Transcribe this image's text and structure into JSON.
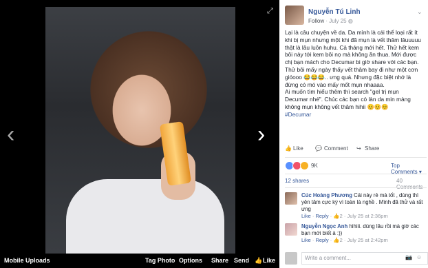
{
  "viewer": {
    "prev_arrow": "‹",
    "next_arrow": "›",
    "expand_icon": "⤢",
    "album": "Mobile Uploads",
    "tag_photo": "Tag Photo",
    "options": "Options",
    "share": "Share",
    "send": "Send",
    "like": "Like"
  },
  "post": {
    "author": "Nguyễn Tú Linh",
    "follow": "Follow",
    "date": "July 25",
    "lines": [
      "Lại là câu chuyện về da. Da mình là cái thể loại rất ít khi bị mụn nhưng một khi đã mụn là vết thâm lâuuuuu thật là lâu luôn huhu. Cả tháng mới hết. Thử hết kem bôi này tới kem bôi nọ mà không ăn thua. Mới được chị bạn mách cho Decumar bi giờ share với các bạn. Thử bôi mấy ngày thấy vết thâm bay đi như một cơn gióooo 😂😂😂.. ưng quá. Nhưng đặc biệt nhớ là đừng có mó vào mấy mốt mụn nhaaaa.",
      "Ai muốn tìm hiểu thêm thì search \"gel trị mụn Decumar nhé\". Chúc các bạn có làn da min màng không mụn không vết thâm hihii 😊😊😊"
    ],
    "hashtag": "#Decumar",
    "actions": {
      "like": "Like",
      "comment": "Comment",
      "share": "Share"
    },
    "reactions_count": "9K",
    "top_comments": "Top Comments ▾",
    "shares": "12 shares",
    "comments_count": "40 Comments"
  },
  "comments": [
    {
      "name": "Cúc Hoàng Phương",
      "text": "Cái này rẻ mà tốt , dùng thì yên tâm cực kỳ vì toàn là nghề . Mình đã thử và rất ưng",
      "like": "Like",
      "reply": "Reply",
      "likes": "2",
      "time": "July 25 at 2:36pm"
    },
    {
      "name": "Nguyễn Ngọc Anh",
      "text": "hihiii. dùng lâu rồi mà giờ các bạn mới biết à :))",
      "like": "Like",
      "reply": "Reply",
      "likes": "2",
      "time": "July 25 at 2:42pm"
    }
  ],
  "write_comment": {
    "placeholder": "Write a comment...",
    "camera_icon": "📷",
    "emoji_icon": "☺"
  },
  "colors": {
    "link": "#365899",
    "like_reaction": "#5890ff",
    "love_reaction": "#f25268",
    "haha_reaction": "#f7b125"
  }
}
